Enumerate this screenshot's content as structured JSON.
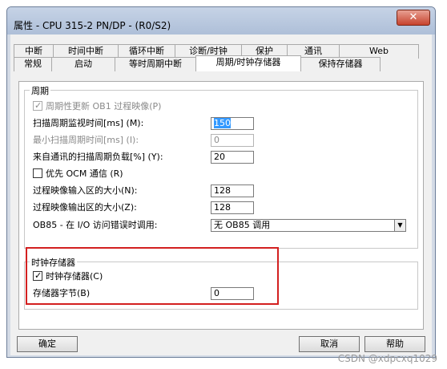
{
  "window": {
    "title": "属性 - CPU 315-2 PN/DP - (R0/S2)",
    "close": "✕"
  },
  "tabs_back": [
    {
      "label": "中断",
      "w": 50
    },
    {
      "label": "时间中断",
      "w": 82
    },
    {
      "label": "循环中断",
      "w": 72
    },
    {
      "label": "诊断/时钟",
      "w": 84
    },
    {
      "label": "保护",
      "w": 58
    },
    {
      "label": "通讯",
      "w": 66
    },
    {
      "label": "Web",
      "w": 100
    }
  ],
  "tabs_front": [
    {
      "label": "常规",
      "w": 48
    },
    {
      "label": "启动",
      "w": 80
    },
    {
      "label": "等时周期中断",
      "w": 102
    },
    {
      "label": "周期/时钟存储器",
      "w": 132,
      "active": true
    },
    {
      "label": "保持存储器",
      "w": 100
    }
  ],
  "cycle": {
    "title": "周期",
    "update_oi": "周期性更新 OB1 过程映像(P)",
    "scan_monitor_label": "扫描周期监视时间[ms] (M):",
    "scan_monitor_value": "150",
    "min_scan_label": "最小扫描周期时间[ms] (I):",
    "min_scan_value": "0",
    "comm_load_label": "来自通讯的扫描周期负载[%] (Y):",
    "comm_load_value": "20",
    "prio_ocm": "优先 OCM 通信 (R)",
    "pi_input_label": "过程映像输入区的大小(N):",
    "pi_input_value": "128",
    "pi_output_label": "过程映像输出区的大小(Z):",
    "pi_output_value": "128",
    "ob85_label": "OB85 - 在 I/O 访问错误时调用:",
    "ob85_value": "无 OB85 调用"
  },
  "clock": {
    "title": "时钟存储器",
    "enable_label": "时钟存储器(C)",
    "byte_label": "存储器字节(B)",
    "byte_value": "0"
  },
  "buttons": {
    "ok": "确定",
    "cancel": "取消",
    "help": "帮助"
  },
  "watermark": "CSDN @xdpcxq1029"
}
